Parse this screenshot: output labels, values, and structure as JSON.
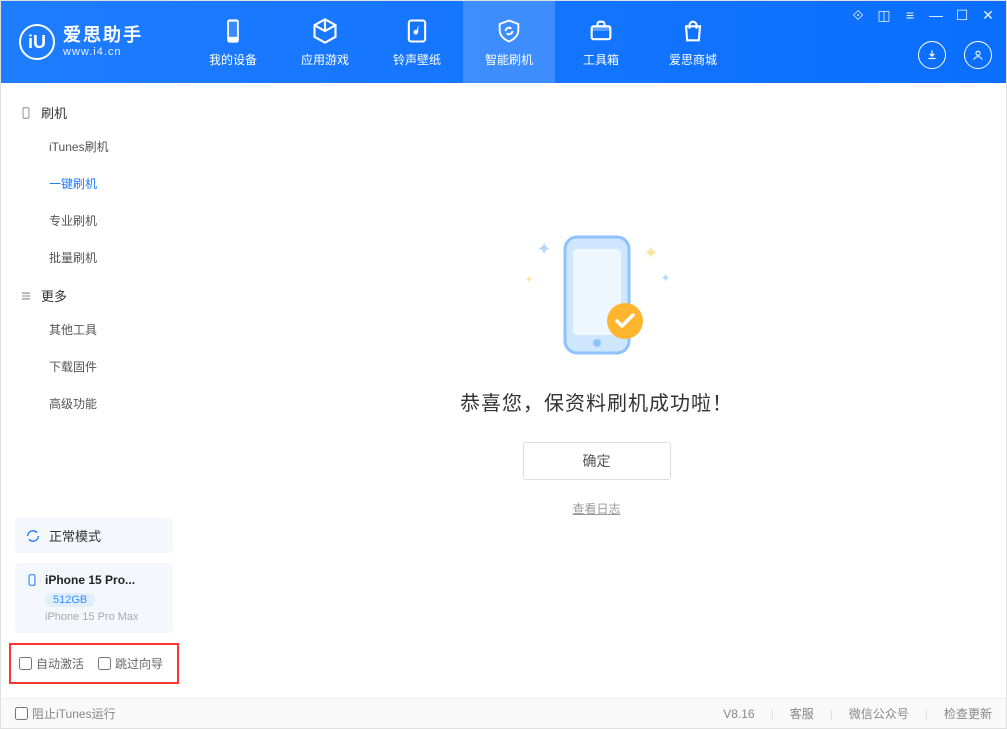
{
  "app": {
    "name": "爱思助手",
    "url": "www.i4.cn"
  },
  "nav": {
    "device": "我的设备",
    "apps": "应用游戏",
    "ringtones": "铃声壁纸",
    "flash": "智能刷机",
    "toolbox": "工具箱",
    "store": "爱思商城"
  },
  "sidebar": {
    "group_flash": "刷机",
    "items_flash": {
      "itunes": "iTunes刷机",
      "onekey": "一键刷机",
      "pro": "专业刷机",
      "batch": "批量刷机"
    },
    "group_more": "更多",
    "items_more": {
      "other": "其他工具",
      "download": "下载固件",
      "advanced": "高级功能"
    },
    "mode": "正常模式",
    "device": {
      "name": "iPhone 15 Pro...",
      "capacity": "512GB",
      "model": "iPhone 15 Pro Max"
    },
    "checks": {
      "auto_activate": "自动激活",
      "skip_wizard": "跳过向导"
    }
  },
  "main": {
    "success": "恭喜您，保资料刷机成功啦！",
    "ok": "确定",
    "view_log": "查看日志"
  },
  "footer": {
    "block_itunes": "阻止iTunes运行",
    "version": "V8.16",
    "support": "客服",
    "wechat": "微信公众号",
    "update": "检查更新"
  }
}
